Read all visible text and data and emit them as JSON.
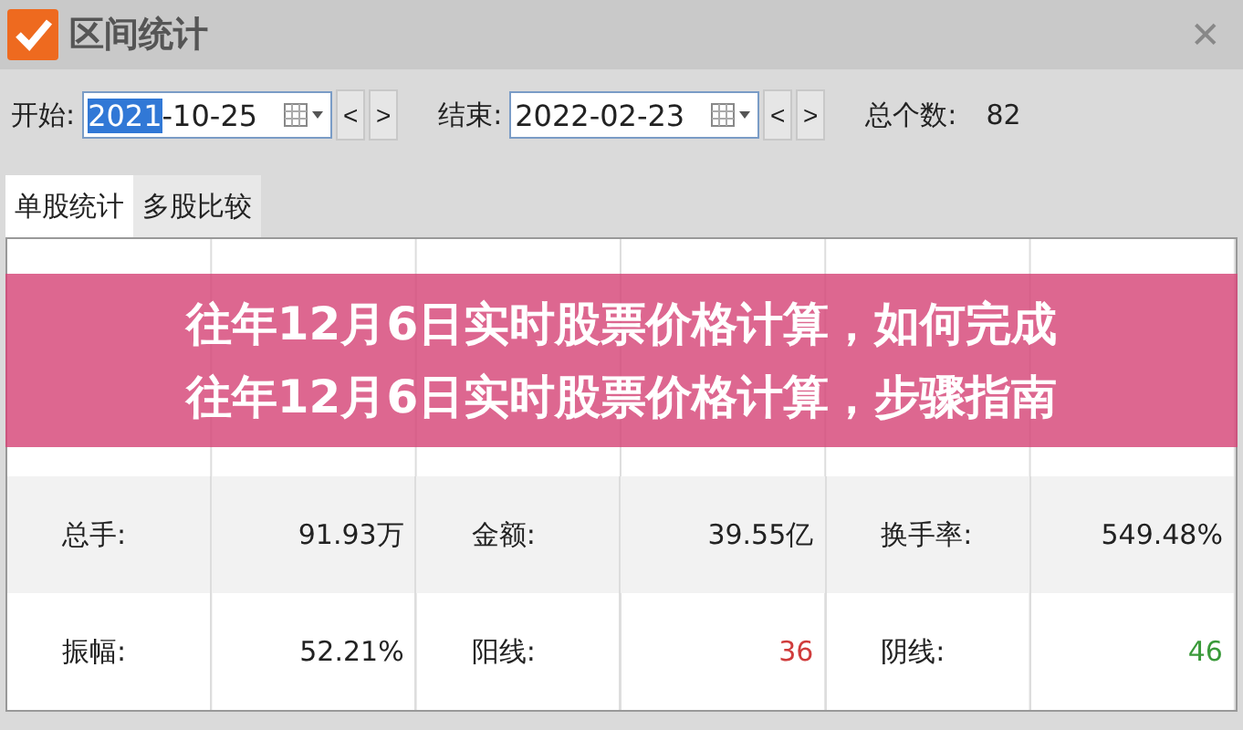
{
  "window": {
    "title": "区间统计",
    "close": "✕"
  },
  "toolbar": {
    "start_label": "开始:",
    "start_date": {
      "selected_part": "2021",
      "rest": "-10-25"
    },
    "end_label": "结束:",
    "end_date": {
      "rest": "2022-02-23"
    },
    "prev": "<",
    "next": ">",
    "count_label": "总个数:",
    "count": "82"
  },
  "tabs": [
    {
      "label": "单股统计",
      "selected": true
    },
    {
      "label": "多股比较",
      "selected": false
    }
  ],
  "table": {
    "rows": [
      {
        "shaded": false
      },
      {
        "shaded": false
      },
      {
        "shaded": true,
        "cells": [
          {
            "text": "总手:"
          },
          {
            "text": "91.93万"
          },
          {
            "text": "金额:"
          },
          {
            "text": "39.55亿"
          },
          {
            "text": "换手率:"
          },
          {
            "text": "549.48%"
          }
        ]
      },
      {
        "shaded": false,
        "cells": [
          {
            "text": "振幅:"
          },
          {
            "text": "52.21%"
          },
          {
            "text": "阳线:"
          },
          {
            "text": "36",
            "color": "#d03c3c"
          },
          {
            "text": "阴线:"
          },
          {
            "text": "46",
            "color": "#3a9a3a"
          }
        ]
      }
    ]
  },
  "banner": {
    "lines": [
      "往年12月6日实时股票价格计算，如何完成",
      "往年12月6日实时股票价格计算，步骤指南"
    ]
  }
}
